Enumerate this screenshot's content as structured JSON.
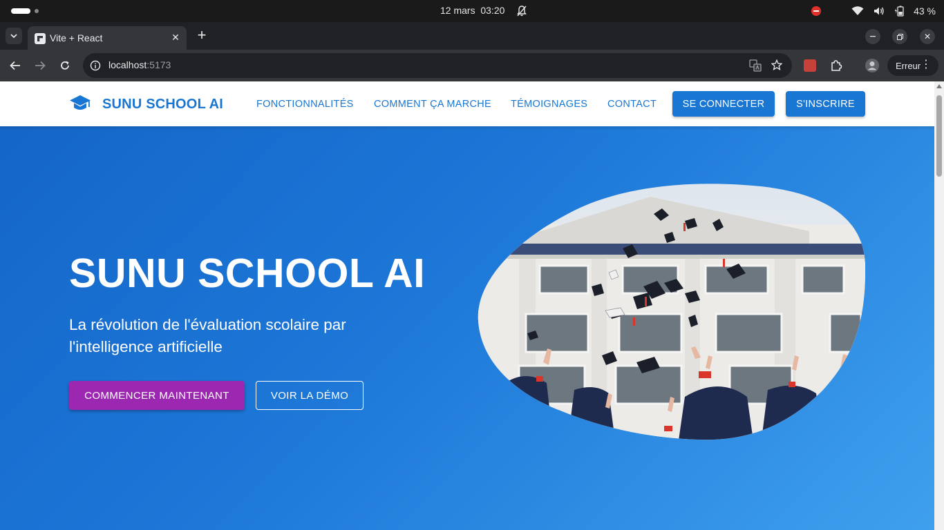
{
  "os": {
    "date": "12 mars",
    "time": "03:20",
    "battery": "43 %"
  },
  "browser": {
    "tab_title": "Vite + React",
    "url_host": "localhost",
    "url_port": ":5173",
    "profile_status": "Erreur"
  },
  "app": {
    "brand": "SUNU SCHOOL AI",
    "nav": {
      "features": "FONCTIONNALITÉS",
      "how_it_works": "COMMENT ÇA MARCHE",
      "testimonials": "TÉMOIGNAGES",
      "contact": "CONTACT",
      "login": "SE CONNECTER",
      "signup": "S'INSCRIRE"
    },
    "hero": {
      "title": "SUNU SCHOOL AI",
      "subtitle": "La révolution de l'évaluation scolaire par l'intelligence artificielle",
      "cta_primary": "COMMENCER MAINTENANT",
      "cta_secondary": "VOIR LA DÉMO",
      "image_subject": "graduates-throwing-caps-photo"
    }
  },
  "colors": {
    "brand_blue": "#1976d2",
    "cta_purple": "#9c27b0",
    "hero_gradient_start": "#1466c8",
    "hero_gradient_end": "#3fa0ee"
  }
}
